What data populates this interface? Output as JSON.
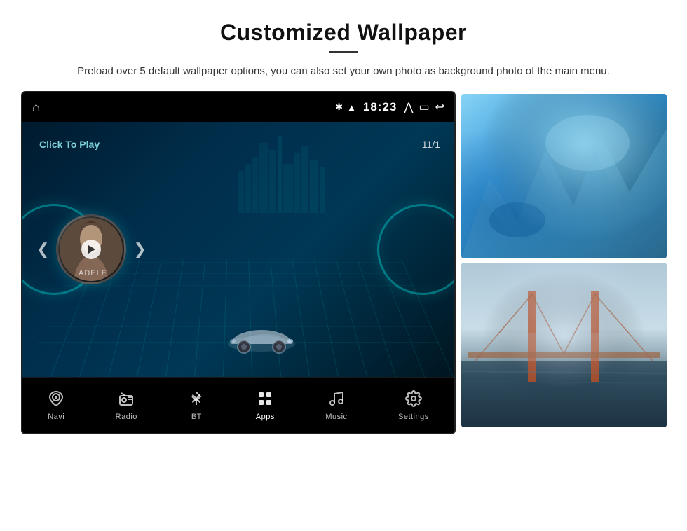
{
  "page": {
    "title": "Customized Wallpaper",
    "divider": "—",
    "subtitle": "Preload over 5 default wallpaper options, you can also set your own photo as background photo of the main menu."
  },
  "car_screen": {
    "status_bar": {
      "time": "18:23",
      "bluetooth_icon": "bluetooth",
      "wifi_icon": "signal",
      "nav_up": "⋀",
      "nav_rect": "▭",
      "nav_back": "↩"
    },
    "music": {
      "click_to_play": "Click To Play",
      "album_name": "ADELE",
      "date": "11/1"
    },
    "bottom_nav": [
      {
        "id": "navi",
        "label": "Navi",
        "icon": "📍"
      },
      {
        "id": "radio",
        "label": "Radio",
        "icon": "📻"
      },
      {
        "id": "bt",
        "label": "BT",
        "icon": "bluetooth"
      },
      {
        "id": "apps",
        "label": "Apps",
        "icon": "apps"
      },
      {
        "id": "music",
        "label": "Music",
        "icon": "🎵"
      },
      {
        "id": "settings",
        "label": "Settings",
        "icon": "⚙"
      }
    ]
  },
  "wallpapers": {
    "thumb1_alt": "Ice cave blue wallpaper",
    "thumb2_alt": "Golden Gate Bridge foggy wallpaper"
  }
}
